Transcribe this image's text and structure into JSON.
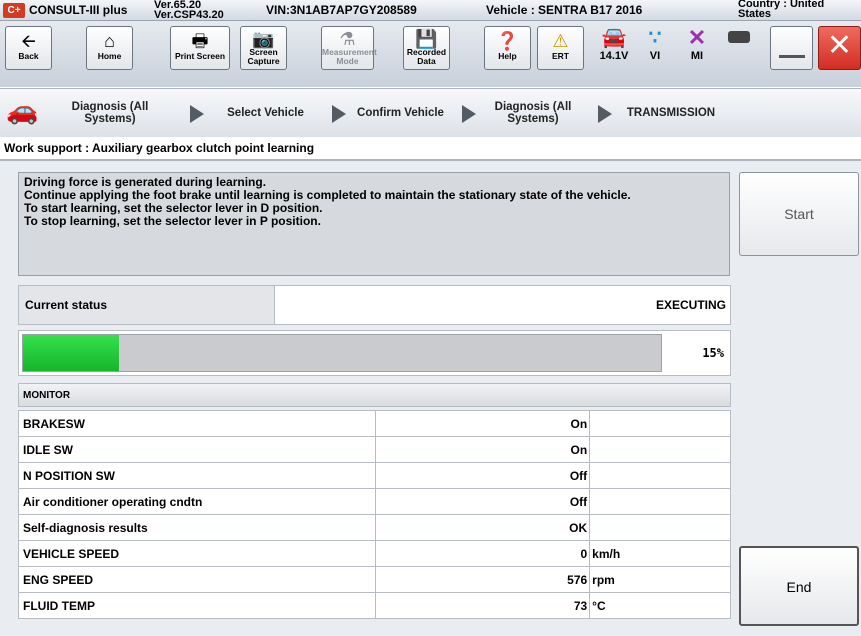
{
  "titlebar": {
    "app_name": "CONSULT-III plus",
    "version_line1": "Ver.65.20",
    "version_line2": "Ver.CSP43.20",
    "vin": "VIN:3N1AB7AP7GY208589",
    "vehicle": "Vehicle : SENTRA B17 2016",
    "country_line1": "Country : United",
    "country_line2": "States",
    "logo": "C+"
  },
  "toolbar": {
    "back": "Back",
    "home": "Home",
    "print_screen": "Print Screen",
    "screen_capture_1": "Screen",
    "screen_capture_2": "Capture",
    "measurement_1": "Measurement",
    "measurement_2": "Mode",
    "recorded_1": "Recorded",
    "recorded_2": "Data",
    "help": "Help",
    "ert": "ERT",
    "voltage": "14.1V",
    "vi": "VI",
    "mi": "MI"
  },
  "breadcrumb": {
    "items": [
      "Diagnosis (All Systems)",
      "Select Vehicle",
      "Confirm Vehicle",
      "Diagnosis (All Systems)",
      "TRANSMISSION"
    ]
  },
  "work_support_title": "Work support : Auxiliary gearbox clutch point learning",
  "instructions": [
    "Driving force is generated during learning.",
    "Continue applying the foot brake until learning is completed to maintain the stationary state of the vehicle.",
    "To start learning, set the selector lever in D position.",
    "To stop learning, set the selector lever in P position."
  ],
  "start_label": "Start",
  "end_label": "End",
  "status": {
    "label": "Current status",
    "value": "EXECUTING"
  },
  "progress": {
    "percent": 15,
    "label": "15%"
  },
  "monitor": {
    "header": "MONITOR",
    "rows": [
      {
        "name": "BRAKESW",
        "value": "On",
        "unit": ""
      },
      {
        "name": "IDLE SW",
        "value": "On",
        "unit": ""
      },
      {
        "name": "N POSITION SW",
        "value": "Off",
        "unit": ""
      },
      {
        "name": "Air conditioner operating cndtn",
        "value": "Off",
        "unit": ""
      },
      {
        "name": "Self-diagnosis results",
        "value": "OK",
        "unit": ""
      },
      {
        "name": "VEHICLE SPEED",
        "value": "0",
        "unit": "km/h"
      },
      {
        "name": "ENG SPEED",
        "value": "576",
        "unit": "rpm"
      },
      {
        "name": "FLUID TEMP",
        "value": "73",
        "unit": "°C"
      }
    ]
  },
  "colors": {
    "progress_fill": "#22c935",
    "close_button": "#e0443a"
  }
}
